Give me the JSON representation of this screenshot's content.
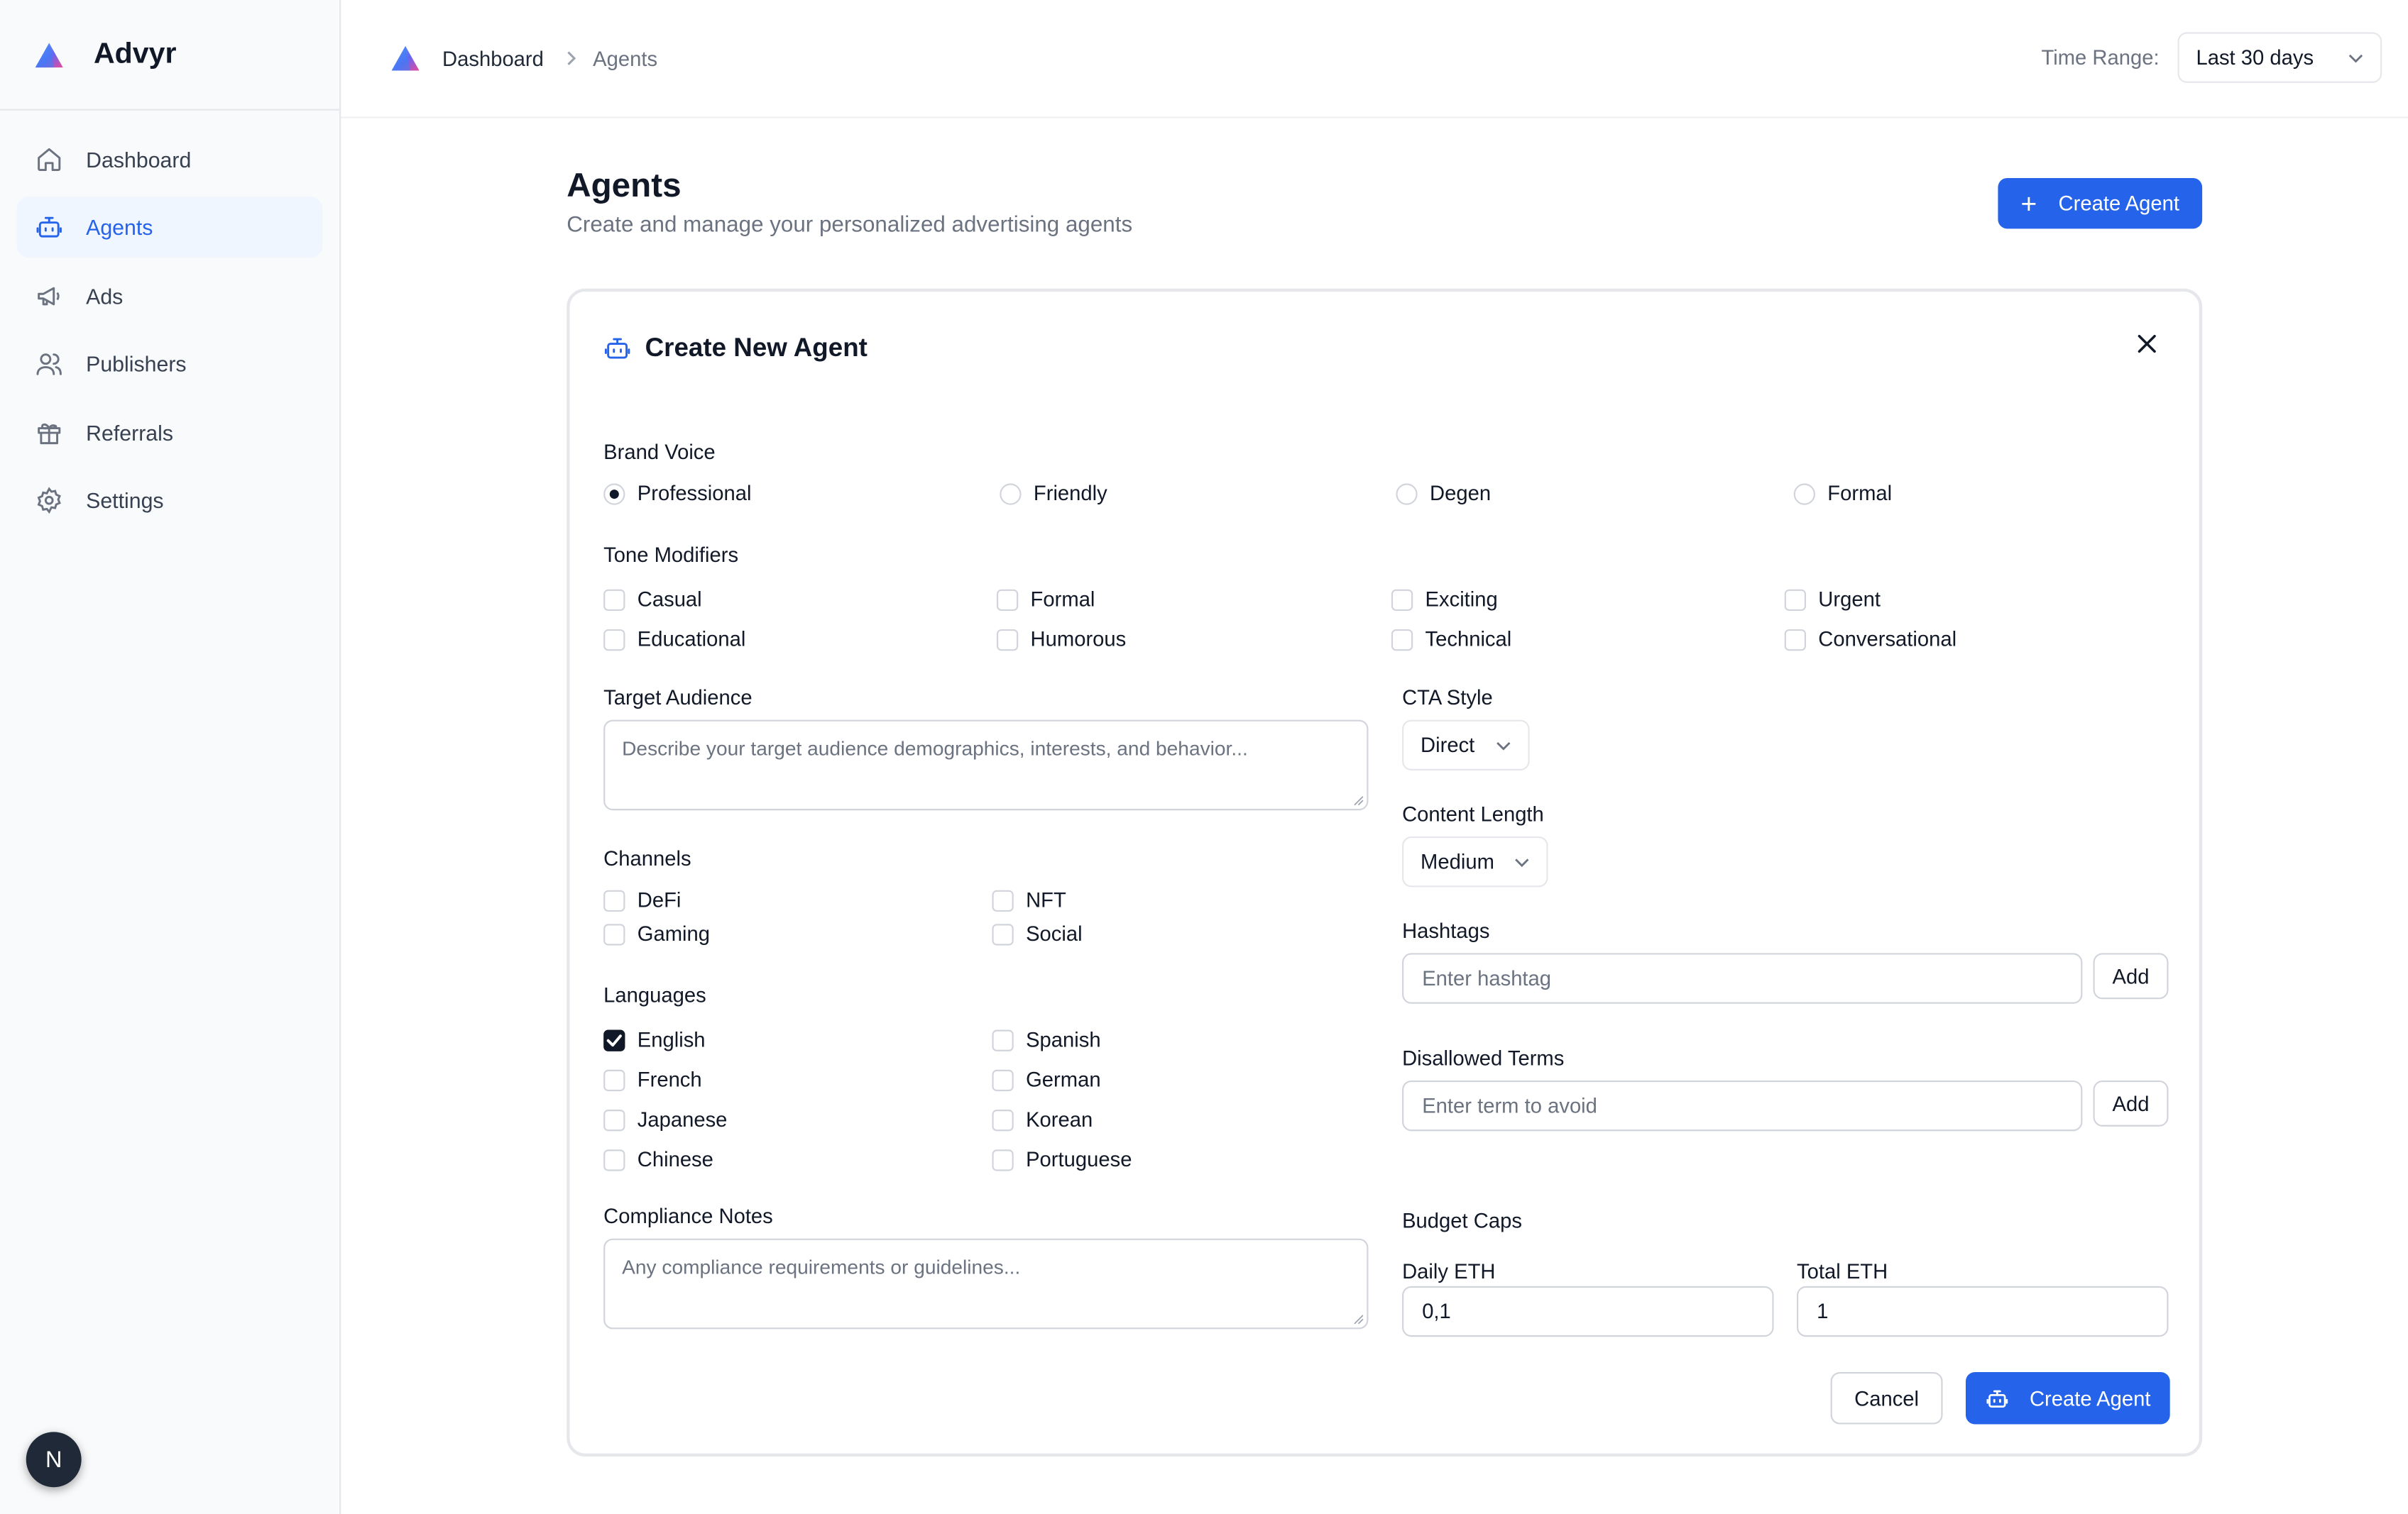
{
  "app": {
    "name": "Advyr"
  },
  "sidebar": {
    "items": [
      {
        "label": "Dashboard",
        "icon": "home-icon"
      },
      {
        "label": "Agents",
        "icon": "robot-icon"
      },
      {
        "label": "Ads",
        "icon": "megaphone-icon"
      },
      {
        "label": "Publishers",
        "icon": "users-icon"
      },
      {
        "label": "Referrals",
        "icon": "gift-icon"
      },
      {
        "label": "Settings",
        "icon": "gear-icon"
      }
    ],
    "active": "Agents",
    "avatar_initial": "N"
  },
  "header": {
    "breadcrumb": [
      "Dashboard",
      "Agents"
    ],
    "time_range_label": "Time Range:",
    "time_range_value": "Last 30 days"
  },
  "page": {
    "title": "Agents",
    "subtitle": "Create and manage your personalized advertising agents",
    "create_button": "Create Agent"
  },
  "form": {
    "title": "Create New Agent",
    "brand_voice": {
      "label": "Brand Voice",
      "options": [
        "Professional",
        "Friendly",
        "Degen",
        "Formal"
      ],
      "selected": "Professional"
    },
    "tone_modifiers": {
      "label": "Tone Modifiers",
      "options": [
        "Casual",
        "Formal",
        "Exciting",
        "Urgent",
        "Educational",
        "Humorous",
        "Technical",
        "Conversational"
      ]
    },
    "target_audience": {
      "label": "Target Audience",
      "placeholder": "Describe your target audience demographics, interests, and behavior..."
    },
    "channels": {
      "label": "Channels",
      "options": [
        "DeFi",
        "NFT",
        "Gaming",
        "Social"
      ]
    },
    "languages": {
      "label": "Languages",
      "options": [
        "English",
        "Spanish",
        "French",
        "German",
        "Japanese",
        "Korean",
        "Chinese",
        "Portuguese"
      ],
      "checked": [
        "English"
      ]
    },
    "compliance_notes": {
      "label": "Compliance Notes",
      "placeholder": "Any compliance requirements or guidelines..."
    },
    "cta_style": {
      "label": "CTA Style",
      "value": "Direct"
    },
    "content_length": {
      "label": "Content Length",
      "value": "Medium"
    },
    "hashtags": {
      "label": "Hashtags",
      "placeholder": "Enter hashtag",
      "add": "Add"
    },
    "disallowed_terms": {
      "label": "Disallowed Terms",
      "placeholder": "Enter term to avoid",
      "add": "Add"
    },
    "budget_caps": {
      "label": "Budget Caps",
      "daily_label": "Daily ETH",
      "daily_value": "0,1",
      "total_label": "Total ETH",
      "total_value": "1"
    },
    "cancel": "Cancel",
    "submit": "Create Agent"
  },
  "colors": {
    "accent": "#2563eb",
    "active_bg": "#eff6ff",
    "sidebar_bg": "#f9fafb",
    "border": "#e5e7eb"
  }
}
